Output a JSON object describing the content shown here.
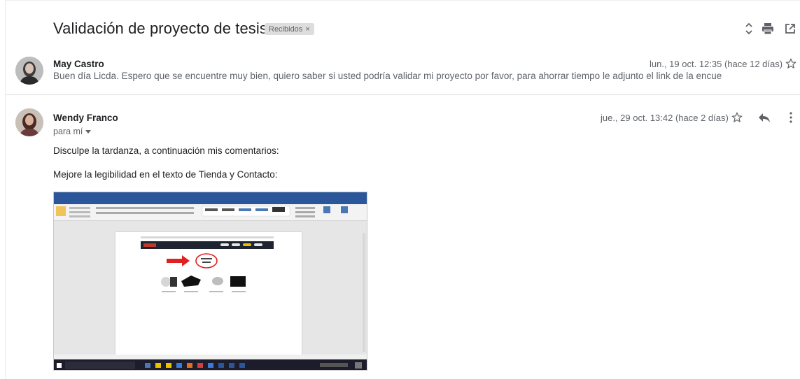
{
  "thread": {
    "subject": "Validación de proyecto de tesis",
    "label": "Recibidos",
    "label_remove": "×"
  },
  "header_icons": [
    "expand-collapse-icon",
    "print-icon",
    "open-in-new-window-icon"
  ],
  "messages": [
    {
      "sender": "May Castro",
      "date": "lun., 19 oct. 12:35 (hace 12 días)",
      "snippet": "Buen día Licda. Espero que se encuentre muy bien, quiero saber si usted podría validar mi proyecto por favor, para ahorrar tiempo le adjunto el link de la encue",
      "collapsed": true
    },
    {
      "sender": "Wendy Franco",
      "date": "jue., 29 oct. 13:42 (hace 2 días)",
      "to": "para mí",
      "body": [
        "Disculpe la tardanza, a continuación mis comentarios:",
        "Mejore la legibilidad en el texto de Tienda y Contacto:"
      ],
      "attachment_description": "screenshot of a Word document",
      "collapsed": false
    }
  ],
  "colors": {
    "text_primary": "#202124",
    "text_secondary": "#5f6368",
    "label_bg": "#dddddd",
    "word_blue": "#2b579a",
    "arrow_red": "#e02020"
  }
}
